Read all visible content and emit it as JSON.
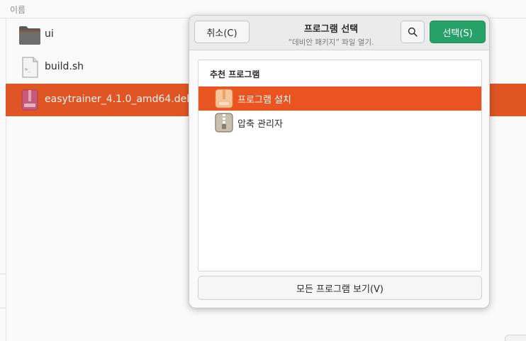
{
  "file_manager": {
    "column_header": "이름",
    "files": [
      {
        "name": "ui",
        "icon": "folder-icon"
      },
      {
        "name": "build.sh",
        "icon": "script-file-icon"
      },
      {
        "name": "easytrainer_4.1.0_amd64.deb",
        "icon": "deb-package-icon",
        "selected": true
      }
    ]
  },
  "dialog": {
    "title": "프로그램 선택",
    "subtitle": "“데비안 패키지” 파일 열기.",
    "cancel_label": "취소(C)",
    "select_label": "선택(S)",
    "search_icon": "search-icon",
    "section_title": "추천 프로그램",
    "apps": [
      {
        "label": "프로그램 설치",
        "icon": "software-install-icon",
        "selected": true
      },
      {
        "label": "압축 관리자",
        "icon": "archive-manager-icon",
        "selected": false
      }
    ],
    "view_all_label": "모든 프로그램 보기(V)"
  },
  "colors": {
    "accent": "#e95420",
    "select_button": "#26a269"
  }
}
